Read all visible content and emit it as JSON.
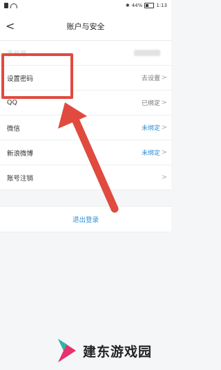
{
  "status_bar": {
    "battery_pct": "44%",
    "time": "1:13"
  },
  "header": {
    "back_glyph": "<",
    "title": "账户与安全"
  },
  "rows": [
    {
      "label": "手机号",
      "value": ""
    },
    {
      "label": "设置密码",
      "value": "去设置"
    },
    {
      "label": "QQ",
      "value": "已绑定"
    },
    {
      "label": "微信",
      "value": "未绑定"
    },
    {
      "label": "新浪微博",
      "value": "未绑定"
    },
    {
      "label": "账号注销",
      "value": ""
    }
  ],
  "logout_label": "退出登录",
  "watermark_text": "建东游戏园",
  "colors": {
    "accent": "#2f8fd4",
    "annotation": "#e04a3f"
  }
}
